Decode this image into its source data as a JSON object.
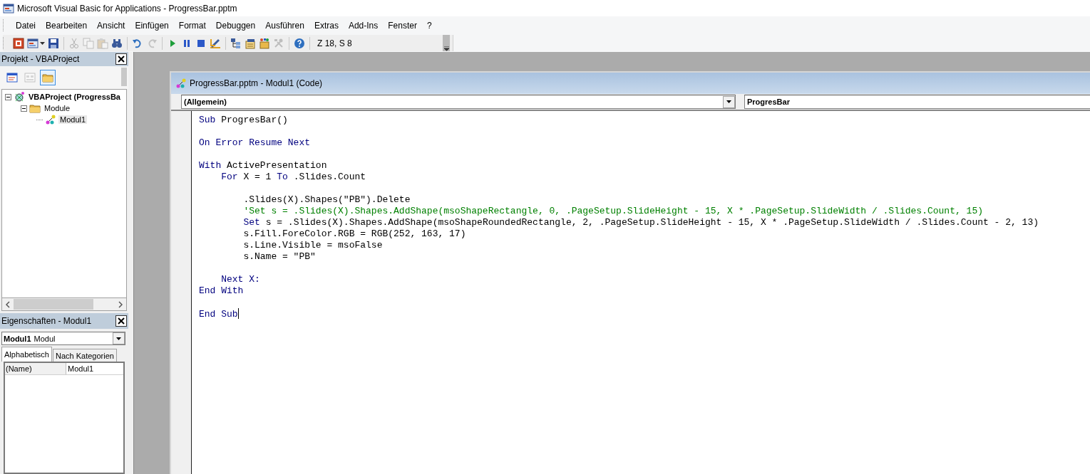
{
  "window": {
    "title": "Microsoft Visual Basic for Applications - ProgressBar.pptm"
  },
  "menu": [
    "Datei",
    "Bearbeiten",
    "Ansicht",
    "Einfügen",
    "Format",
    "Debuggen",
    "Ausführen",
    "Extras",
    "Add-Ins",
    "Fenster",
    "?"
  ],
  "toolbar": {
    "buttons": [
      {
        "kind": "slide",
        "disabled": false
      },
      {
        "kind": "form",
        "disabled": false
      },
      {
        "kind": "save",
        "disabled": false
      },
      {
        "kind": "separator"
      },
      {
        "kind": "cut",
        "disabled": true
      },
      {
        "kind": "copy",
        "disabled": true
      },
      {
        "kind": "paste",
        "disabled": true
      },
      {
        "kind": "search",
        "disabled": false
      },
      {
        "kind": "separator"
      },
      {
        "kind": "undo",
        "disabled": false
      },
      {
        "kind": "redo",
        "disabled": true
      },
      {
        "kind": "separator"
      },
      {
        "kind": "play",
        "disabled": false
      },
      {
        "kind": "pause",
        "disabled": false
      },
      {
        "kind": "stop",
        "disabled": false
      },
      {
        "kind": "ruler",
        "disabled": false
      },
      {
        "kind": "separator"
      },
      {
        "kind": "project",
        "disabled": false
      },
      {
        "kind": "properties",
        "disabled": false
      },
      {
        "kind": "box",
        "disabled": false
      },
      {
        "kind": "tools",
        "disabled": true
      },
      {
        "kind": "separator"
      },
      {
        "kind": "help",
        "disabled": false
      }
    ],
    "position": "Z 18, S 8"
  },
  "project": {
    "title": "Projekt - VBAProject",
    "toolbar": [
      {
        "kind": "code",
        "disabled": false,
        "selected": false
      },
      {
        "kind": "object",
        "disabled": true,
        "selected": false
      },
      {
        "kind": "folder",
        "disabled": false,
        "selected": true
      }
    ],
    "tree": [
      {
        "label": "VBAProject (ProgressBa",
        "kind": "project",
        "expanded": true,
        "selected": false,
        "children": [
          {
            "label": "Module",
            "kind": "folder",
            "expanded": true,
            "selected": false,
            "children": [
              {
                "label": "Modul1",
                "kind": "module",
                "selected": true
              }
            ]
          }
        ]
      }
    ]
  },
  "properties": {
    "title": "Eigenschaften - Modul1",
    "object_name": "Modul1",
    "object_type": "Modul",
    "tabs": [
      {
        "label": "Alphabetisch",
        "selected": true
      },
      {
        "label": "Nach Kategorien",
        "selected": false
      }
    ],
    "rows": [
      {
        "name": "(Name)",
        "value": "Modul1"
      }
    ]
  },
  "code_window": {
    "title": "ProgressBar.pptm - Modul1 (Code)",
    "object": "(Allgemein)",
    "procedure": "ProgresBar",
    "lines": [
      {
        "kind": "code",
        "caret": false,
        "tokens": [
          {
            "kind": "keyword",
            "text": "Sub"
          },
          {
            "kind": "plain",
            "text": " ProgresBar()"
          }
        ]
      },
      {
        "kind": "blank"
      },
      {
        "kind": "code",
        "caret": false,
        "tokens": [
          {
            "kind": "keyword",
            "text": "On Error Resume Next"
          }
        ]
      },
      {
        "kind": "blank"
      },
      {
        "kind": "code",
        "caret": false,
        "tokens": [
          {
            "kind": "keyword",
            "text": "With"
          },
          {
            "kind": "plain",
            "text": " ActivePresentation"
          }
        ]
      },
      {
        "kind": "code",
        "caret": false,
        "tokens": [
          {
            "kind": "keyword",
            "text": "    For"
          },
          {
            "kind": "plain",
            "text": " X = 1 "
          },
          {
            "kind": "keyword",
            "text": "To"
          },
          {
            "kind": "plain",
            "text": " .Slides.Count"
          }
        ]
      },
      {
        "kind": "blank"
      },
      {
        "kind": "code",
        "caret": false,
        "tokens": [
          {
            "kind": "plain",
            "text": "        .Slides(X).Shapes(\"PB\").Delete"
          }
        ]
      },
      {
        "kind": "code",
        "caret": false,
        "tokens": [
          {
            "kind": "comment",
            "text": "        'Set s = .Slides(X).Shapes.AddShape(msoShapeRectangle, 0, .PageSetup.SlideHeight - 15, X * .PageSetup.SlideWidth / .Slides.Count, 15)"
          }
        ]
      },
      {
        "kind": "code",
        "caret": false,
        "tokens": [
          {
            "kind": "keyword",
            "text": "        Set"
          },
          {
            "kind": "plain",
            "text": " s = .Slides(X).Shapes.AddShape(msoShapeRoundedRectangle, 2, .PageSetup.SlideHeight - 15, X * .PageSetup.SlideWidth / .Slides.Count - 2, 13)"
          }
        ]
      },
      {
        "kind": "code",
        "caret": false,
        "tokens": [
          {
            "kind": "plain",
            "text": "        s.Fill.ForeColor.RGB = RGB(252, 163, 17)"
          }
        ]
      },
      {
        "kind": "code",
        "caret": false,
        "tokens": [
          {
            "kind": "plain",
            "text": "        s.Line.Visible = msoFalse"
          }
        ]
      },
      {
        "kind": "code",
        "caret": false,
        "tokens": [
          {
            "kind": "plain",
            "text": "        s.Name = \"PB\""
          }
        ]
      },
      {
        "kind": "blank"
      },
      {
        "kind": "code",
        "caret": false,
        "tokens": [
          {
            "kind": "keyword",
            "text": "    Next X:"
          }
        ]
      },
      {
        "kind": "code",
        "caret": false,
        "tokens": [
          {
            "kind": "keyword",
            "text": "End With"
          }
        ]
      },
      {
        "kind": "blank"
      },
      {
        "kind": "code",
        "caret": true,
        "tokens": [
          {
            "kind": "keyword",
            "text": "End Sub"
          }
        ]
      }
    ]
  }
}
